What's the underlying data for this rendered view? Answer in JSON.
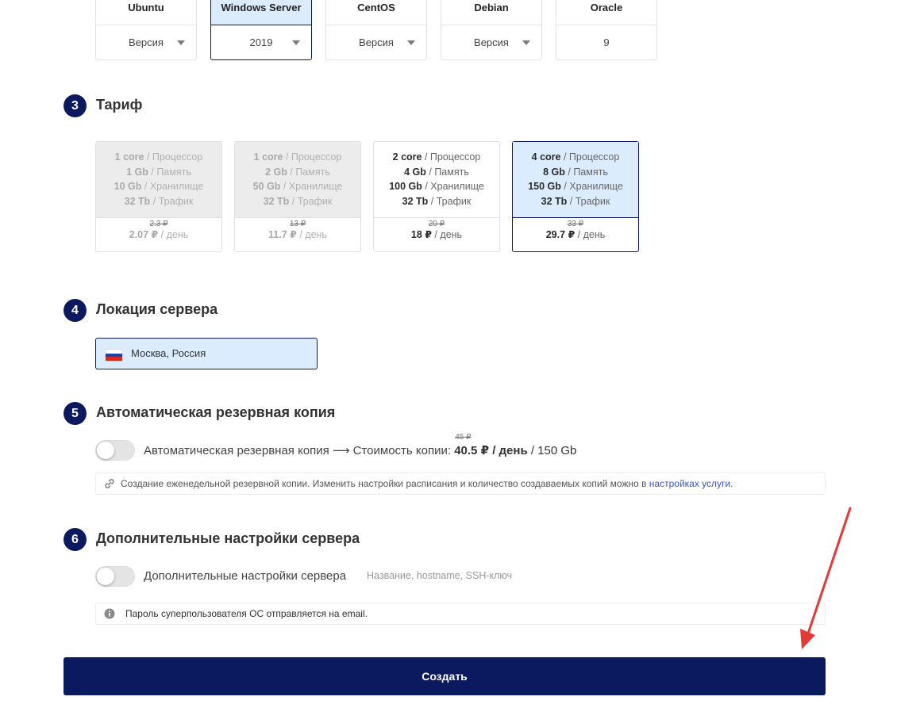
{
  "os": [
    {
      "name": "Ubuntu",
      "version": "Версия",
      "has_caret": true
    },
    {
      "name": "Windows Server",
      "version": "2019",
      "has_caret": true
    },
    {
      "name": "CentOS",
      "version": "Версия",
      "has_caret": true
    },
    {
      "name": "Debian",
      "version": "Версия",
      "has_caret": true
    },
    {
      "name": "Oracle",
      "version": "9",
      "has_caret": false
    }
  ],
  "sections": {
    "tariff": {
      "num": "3",
      "title": "Тариф"
    },
    "location": {
      "num": "4",
      "title": "Локация сервера"
    },
    "backup": {
      "num": "5",
      "title": "Автоматическая резервная копия"
    },
    "extra": {
      "num": "6",
      "title": "Дополнительные настройки сервера"
    }
  },
  "plan_units": {
    "cpu": " / Процессор",
    "ram": " / Память",
    "disk": " / Хранилище",
    "traffic": " / Трафик",
    "day": " / день"
  },
  "plans": [
    {
      "cpu": "1 core",
      "ram": "1 Gb",
      "disk": "10 Gb",
      "traffic": "32 Tb",
      "old": "2.3 ₽",
      "price": "2.07 ₽"
    },
    {
      "cpu": "1 core",
      "ram": "2 Gb",
      "disk": "50 Gb",
      "traffic": "32 Tb",
      "old": "13 ₽",
      "price": "11.7 ₽"
    },
    {
      "cpu": "2 core",
      "ram": "4 Gb",
      "disk": "100 Gb",
      "traffic": "32 Tb",
      "old": "20 ₽",
      "price": "18 ₽"
    },
    {
      "cpu": "4 core",
      "ram": "8 Gb",
      "disk": "150 Gb",
      "traffic": "32 Tb",
      "old": "33 ₽",
      "price": "29.7 ₽"
    }
  ],
  "location": {
    "label": "Москва, Россия",
    "flag_colors": [
      "#ffffff",
      "#1c3fa8",
      "#d52b1e"
    ]
  },
  "backup": {
    "label": "Автоматическая резервная копия",
    "arrow": "⟶",
    "cost_label": "Стоимость копии:",
    "old_price": "45 ₽",
    "price": "40.5 ₽",
    "per_day": "/ день",
    "size": "/ 150 Gb",
    "info_text": "Создание еженедельной резервной копии. Изменить настройки расписания и количество создаваемых копий можно в",
    "info_link": "настройках услуги",
    "info_end": "."
  },
  "extra": {
    "label": "Дополнительные настройки сервера",
    "hint": "Название, hostname, SSH-ключ",
    "info_text": "Пароль суперпользователя ОС отправляется на email."
  },
  "create_button": "Создать",
  "colors": {
    "accent": "#0b1a5e",
    "selected_bg": "#dcecff",
    "arrow": "#e53935"
  }
}
